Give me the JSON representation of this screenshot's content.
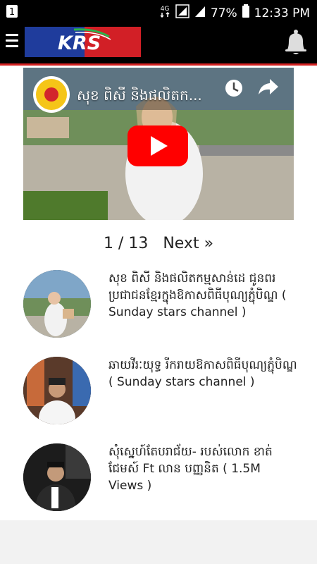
{
  "statusbar": {
    "sim_label": "1",
    "network": "4G",
    "battery": "77%",
    "time": "12:33 PM"
  },
  "appbar": {
    "logo_text": "KRS",
    "menu_icon": "hamburger-icon",
    "bell_icon": "bell-icon",
    "accent_color": "#d42222"
  },
  "video": {
    "title": "សុខ ពិសី និងផលិតក...",
    "play_icon": "youtube-play-icon",
    "clock_icon": "clock-icon",
    "share_icon": "share-icon"
  },
  "pager": {
    "count": "1 / 13",
    "next": "Next »"
  },
  "items": [
    {
      "title": "សុខ ពិសី និងផលិតកម្មសាន់ដេ ជូនពរប្រជាជនខ្មែរក្នុងឱកាសពិធីបុណ្យភ្ជុំបិណ្ឌ ( Sunday stars channel )"
    },
    {
      "title": "ឆាយវីរៈយុទ្ធ រីករាយឱកាសពិធីបុណ្យភ្ជុំបិណ្ឌ ( Sunday stars channel )"
    },
    {
      "title": "សុំស្នេហ៍តែបរាជ័យ- របស់លោក ខាត់ ជែមស៍ Ft លាន បញ្ញនិត ( 1.5M Views )"
    }
  ]
}
